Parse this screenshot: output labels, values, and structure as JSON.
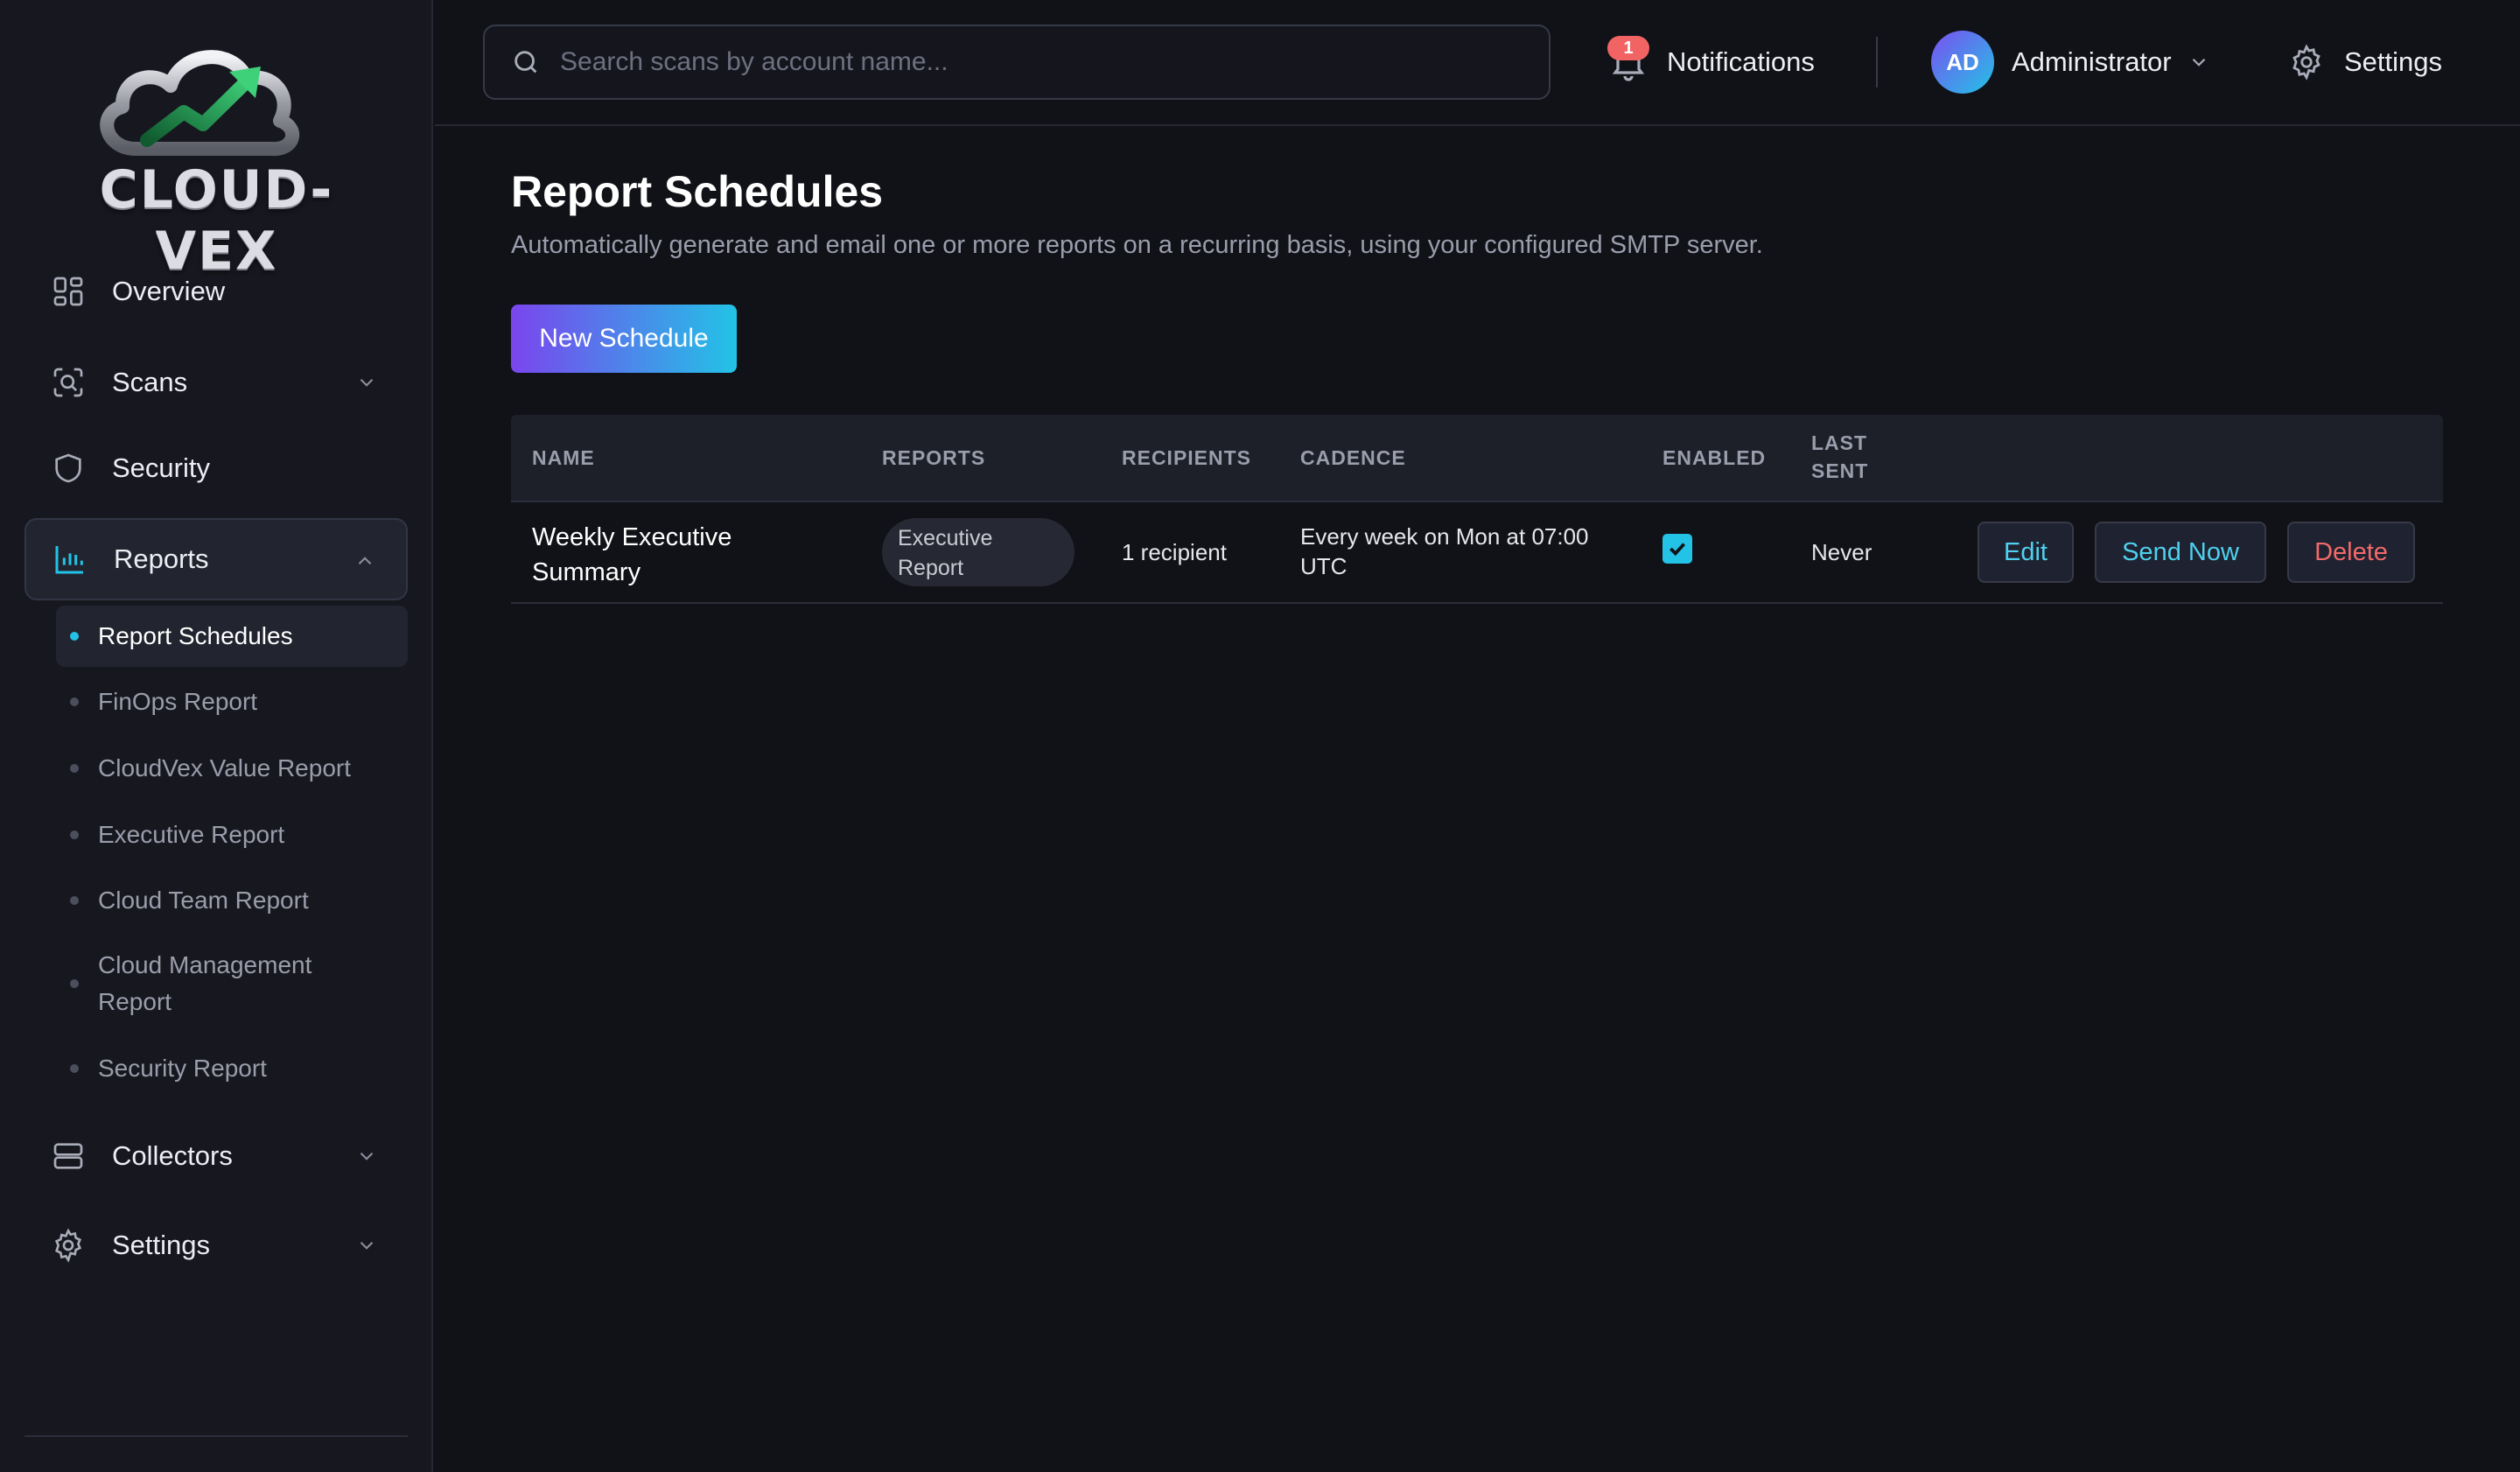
{
  "brand": {
    "name": "CLOUD-VEX"
  },
  "sidebar": {
    "items": [
      {
        "label": "Overview",
        "icon": "grid-icon"
      },
      {
        "label": "Scans",
        "icon": "scan-icon"
      },
      {
        "label": "Security",
        "icon": "shield-icon"
      },
      {
        "label": "Reports",
        "icon": "bar-chart-icon"
      },
      {
        "label": "Collectors",
        "icon": "server-icon"
      },
      {
        "label": "Settings",
        "icon": "gear-icon"
      }
    ],
    "report_subitems": [
      {
        "label": "Report Schedules",
        "active": true
      },
      {
        "label": "FinOps Report"
      },
      {
        "label": "CloudVex Value Report"
      },
      {
        "label": "Executive Report"
      },
      {
        "label": "Cloud Team Report"
      },
      {
        "label": "Cloud Management Report"
      },
      {
        "label": "Security Report"
      }
    ]
  },
  "topbar": {
    "search_placeholder": "Search scans by account name...",
    "notifications_label": "Notifications",
    "notifications_count": "1",
    "user_initials": "AD",
    "user_name": "Administrator",
    "settings_label": "Settings"
  },
  "main": {
    "title": "Report Schedules",
    "subtitle": "Automatically generate and email one or more reports on a recurring basis, using your configured SMTP server.",
    "new_button": "New Schedule",
    "table": {
      "headers": {
        "name": "NAME",
        "reports": "REPORTS",
        "recipients": "RECIPIENTS",
        "cadence": "CADENCE",
        "enabled": "ENABLED",
        "last_sent_1": "LAST",
        "last_sent_2": "SENT"
      },
      "rows": [
        {
          "name_1": "Weekly Executive",
          "name_2": "Summary",
          "report_1": "Executive",
          "report_2": "Report",
          "recipients": "1 recipient",
          "cadence_1": "Every week on Mon at 07:00",
          "cadence_2": "UTC",
          "enabled": true,
          "last_sent": "Never",
          "edit": "Edit",
          "send_now": "Send Now",
          "delete": "Delete"
        }
      ]
    }
  },
  "colors": {
    "accent": "#22c3e6",
    "brand_gradient_start": "#7a45ee",
    "danger": "#f26a6a",
    "background": "#111218",
    "sidebar": "#17181f"
  }
}
